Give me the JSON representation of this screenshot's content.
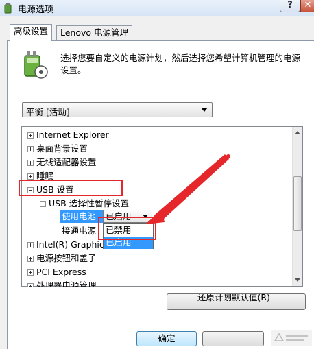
{
  "window": {
    "title": "电源选项",
    "help_label": "?",
    "close_label": "✕"
  },
  "tabs": [
    {
      "label": "高级设置",
      "active": true
    },
    {
      "label": "Lenovo 电源管理",
      "active": false
    }
  ],
  "intro_text": "选择您要自定义的电源计划，然后选择您希望计算机管理的电源设置。",
  "plan_select": {
    "value": "平衡 [活动]"
  },
  "tree": {
    "items": [
      {
        "label": "Internet Explorer",
        "expander": "plus"
      },
      {
        "label": "桌面背景设置",
        "expander": "plus"
      },
      {
        "label": "无线适配器设置",
        "expander": "plus"
      },
      {
        "label": "睡眠",
        "expander": "plus"
      },
      {
        "label": "USB 设置",
        "expander": "minus"
      },
      {
        "label": "USB 选择性暂停设置",
        "expander": "minus"
      },
      {
        "label": "使用电池",
        "expander": "none"
      },
      {
        "label": "接通电源",
        "expander": "none"
      },
      {
        "label": "Intel(R) Graphics Settings",
        "expander": "plus"
      },
      {
        "label": "电源按钮和盖子",
        "expander": "plus"
      },
      {
        "label": "PCI Express",
        "expander": "plus"
      },
      {
        "label": "处理器电源管理",
        "expander": "plus"
      }
    ]
  },
  "setting_dropdown": {
    "current": "已启用",
    "options": [
      "已禁用",
      "已启用"
    ],
    "highlighted": "已启用"
  },
  "buttons": {
    "restore": "还原计划默认值(R)",
    "ok": "确定",
    "cancel": ""
  },
  "annotation_color": "#e5262b",
  "accent_color": "#3399ff"
}
